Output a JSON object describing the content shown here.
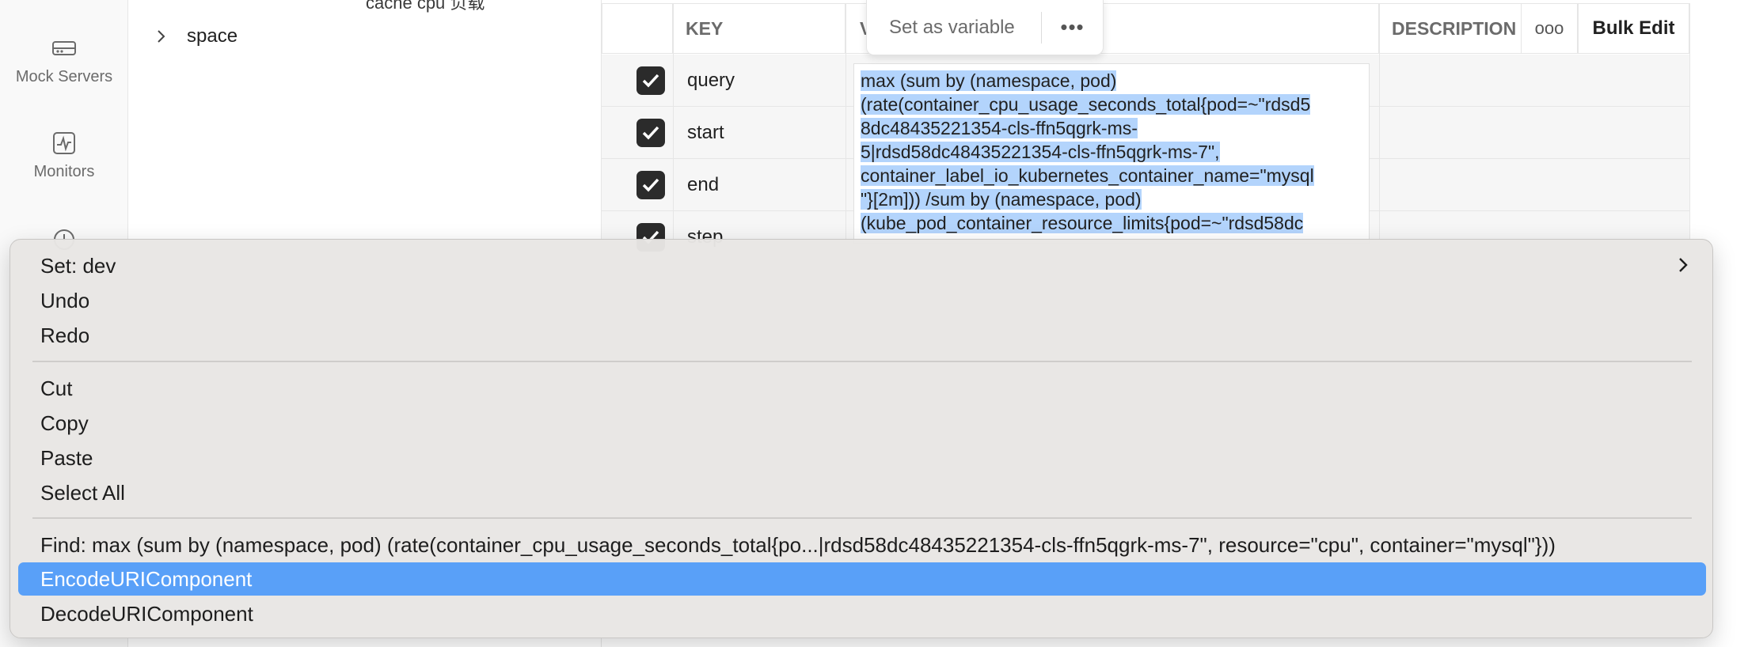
{
  "sidebar": {
    "items": [
      {
        "label": "Mock Servers",
        "icon": "mock-server-icon"
      },
      {
        "label": "Monitors",
        "icon": "monitor-icon"
      },
      {
        "label": "",
        "icon": "history-icon"
      }
    ]
  },
  "tree": {
    "partial_label": "cache cpu 负载",
    "folder_label": "space"
  },
  "params_table": {
    "headers": {
      "key": "KEY",
      "value": "V",
      "description": "DESCRIPTION",
      "more": "ooo",
      "bulk_edit": "Bulk Edit"
    },
    "rows": [
      {
        "key": "query",
        "checked": true
      },
      {
        "key": "start",
        "checked": true
      },
      {
        "key": "end",
        "checked": true
      },
      {
        "key": "step",
        "checked": true
      }
    ],
    "value_lines": [
      "max (sum by (namespace, pod)",
      "(rate(container_cpu_usage_seconds_total{pod=~\"rdsd5",
      "8dc48435221354-cls-ffn5qgrk-ms-",
      "5|rdsd58dc48435221354-cls-ffn5qgrk-ms-7\",",
      "container_label_io_kubernetes_container_name=\"mysql",
      "\"}[2m]))  /sum by (namespace, pod)",
      "(kube_pod_container_resource_limits{pod=~\"rdsd58dc"
    ]
  },
  "floatbar": {
    "label": "Set as variable",
    "more": "•••"
  },
  "context_menu": {
    "items": [
      {
        "label": "Set: dev",
        "submenu": true
      },
      {
        "label": "Undo"
      },
      {
        "label": "Redo"
      },
      {
        "label": "Cut"
      },
      {
        "label": "Copy"
      },
      {
        "label": "Paste"
      },
      {
        "label": "Select All"
      },
      {
        "label": "Find: max (sum by (namespace, pod) (rate(container_cpu_usage_seconds_total{po...|rdsd58dc48435221354-cls-ffn5qgrk-ms-7\", resource=\"cpu\", container=\"mysql\"}))"
      },
      {
        "label": "EncodeURIComponent",
        "highlighted": true
      },
      {
        "label": "DecodeURIComponent"
      }
    ]
  },
  "colors": {
    "highlight": "#59a0f8",
    "selection": "#b3d4fc",
    "checkbox": "#2b2b2b"
  }
}
